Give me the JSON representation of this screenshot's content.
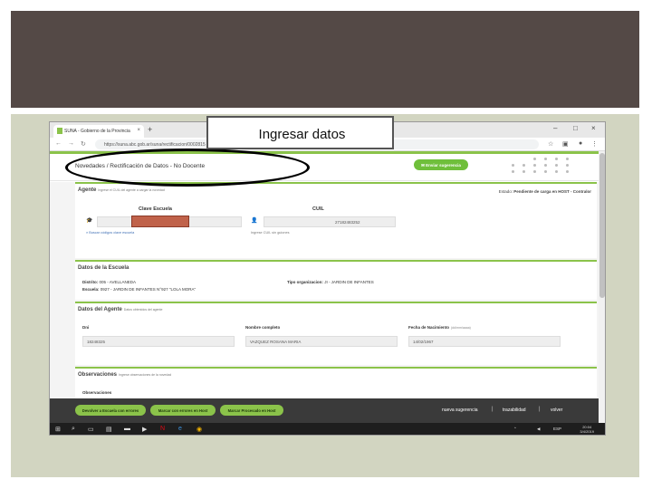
{
  "browser": {
    "tab_title": "SUNA - Gobierno de la Provincia",
    "tab_close": "×",
    "new_tab": "+",
    "url": "https://suna.abc.gob.ar/suna/rectificacion/0002815",
    "win_min": "–",
    "win_max": "□",
    "win_close": "×"
  },
  "callout": {
    "text": "Ingresar datos"
  },
  "page": {
    "title": "Novedades / Rectificación de Datos - No Docente",
    "send_button": "Enviar sugerencia"
  },
  "agente": {
    "title": "Agente",
    "subtitle": "Ingrese el CUIL del agente a cargar la novedad",
    "estado_label": "Estado:",
    "estado_value": "Pendiente de carga en HOST - Contralor",
    "clave_header": "Clave Escuela",
    "cuil_header": "CUIL",
    "cuil_value": "27182483252",
    "buscar_link": "Buscar códigos clave escuela",
    "cuil_hint": "Ingrese CUIL sin guiones"
  },
  "escuela": {
    "title": "Datos de la Escuela",
    "distrito_label": "Distrito:",
    "distrito_value": "005 - AVELLANEDA",
    "escuela_label": "Escuela:",
    "escuela_value": "0927 - JARDIN DE INFANTES N°927 \"LOLA MORA\"",
    "tipo_label": "Tipo organizacion:",
    "tipo_value": "JI - JARDIN DE INFANTES"
  },
  "datos_agente": {
    "title": "Datos del Agente",
    "subtitle": "Datos obtenidos del agente",
    "dni_label": "Dni",
    "dni_value": "18248325",
    "nombre_label": "Nombre completo",
    "nombre_value": "VAZQUEZ ROSANA MARIA",
    "fecha_label": "Fecha de Nacimiento",
    "fecha_format": "(dd/mm/aaaa)",
    "fecha_value": "14/02/1967"
  },
  "observaciones": {
    "title": "Observaciones",
    "subtitle": "Ingrese observaciones de la novedad",
    "label": "Observaciones"
  },
  "actions": {
    "btn1": "Devolver a Escuela con errores",
    "btn2": "Marcar con errores en Host",
    "btn3": "Marcar Procesado en Host",
    "link1": "nueva sugerencia",
    "link2": "trazabilidad",
    "link3": "volver",
    "sep": "|"
  },
  "taskbar": {
    "lang": "ESP",
    "time": "20:04",
    "date": "3/4/2019"
  },
  "colors": {
    "accent": "#8bc34a",
    "header_band": "#544946",
    "slide_bg": "#d2d5c1"
  }
}
